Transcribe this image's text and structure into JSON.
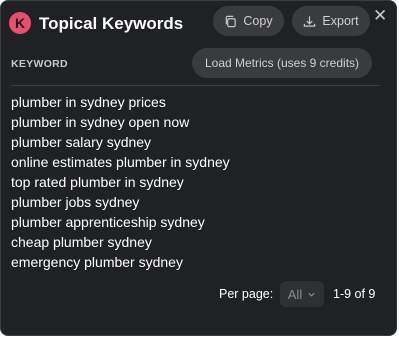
{
  "header": {
    "logo_letter": "K",
    "title": "Topical Keywords",
    "copy_label": "Copy",
    "export_label": "Export",
    "close_glyph": "✕"
  },
  "table": {
    "column_header": "KEYWORD",
    "load_metrics_label": "Load Metrics (uses 9 credits)",
    "keywords": [
      "plumber in sydney prices",
      "plumber in sydney open now",
      "plumber salary sydney",
      "online estimates plumber in sydney",
      "top rated plumber in sydney",
      "plumber jobs sydney",
      "plumber apprenticeship sydney",
      "cheap plumber sydney",
      "emergency plumber sydney"
    ]
  },
  "pagination": {
    "per_page_label": "Per page:",
    "per_page_value": "All",
    "range_text": "1-9 of 9"
  },
  "colors": {
    "panel_bg": "#202124",
    "button_bg": "#3a3b3e",
    "logo_accent": "#e94f6f"
  },
  "icons": {
    "logo": "k-logo-icon",
    "copy": "copy-icon",
    "export": "download-icon",
    "close": "close-icon",
    "dropdown": "chevron-down-icon"
  }
}
